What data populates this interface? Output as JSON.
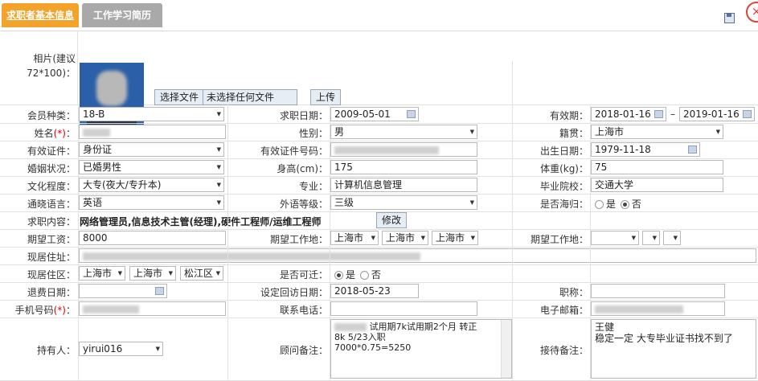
{
  "tabs": [
    "求职者基本信息",
    "工作学习简历"
  ],
  "photo": {
    "label": "相片(建议72*100)：",
    "choose_button": "选择文件",
    "no_file": "未选择任何文件",
    "upload_button": "上传"
  },
  "member_type": {
    "label": "会员种类：",
    "value": "18-B"
  },
  "job_date": {
    "label": "求职日期：",
    "value": "2009-05-01"
  },
  "validity": {
    "label": "有效期：",
    "from": "2018-01-16",
    "sep": "–",
    "to": "2019-01-16"
  },
  "name": {
    "label": "姓名",
    "req": "(*)",
    "colon": "："
  },
  "gender": {
    "label": "性别：",
    "value": "男"
  },
  "native": {
    "label": "籍贯：",
    "value": "上海市"
  },
  "id_type": {
    "label": "有效证件：",
    "value": "身份证"
  },
  "id_no": {
    "label": "有效证件号码："
  },
  "birth": {
    "label": "出生日期：",
    "value": "1979-11-18"
  },
  "marital": {
    "label": "婚姻状况：",
    "value": "已婚男性"
  },
  "height": {
    "label": "身高(cm)：",
    "value": "175"
  },
  "weight": {
    "label": "体重(kg)：",
    "value": "75"
  },
  "education": {
    "label": "文化程度：",
    "value": "大专(夜大/专升本)"
  },
  "major": {
    "label": "专业：",
    "value": "计算机信息管理"
  },
  "school": {
    "label": "毕业院校：",
    "value": "交通大学"
  },
  "language": {
    "label": "通晓语言：",
    "value": "英语"
  },
  "lang_level": {
    "label": "外语等级：",
    "value": "三级"
  },
  "returnee": {
    "label": "是否海归：",
    "yes": "是",
    "no": "否"
  },
  "job_content": {
    "label": "求职内容：",
    "value": "网络管理员,信息技术主管(经理),硬件工程师/运维工程师",
    "edit_button": "修改"
  },
  "salary": {
    "label": "期望工资：",
    "value": "8000"
  },
  "work_place": {
    "label": "期望工作地：",
    "v1": "上海市",
    "v2": "上海市",
    "v3": "上海市"
  },
  "work_place2": {
    "label": "期望工作地："
  },
  "address": {
    "label": "现居住址："
  },
  "area": {
    "label": "现居住区：",
    "v1": "上海市",
    "v2": "上海市",
    "v3": "松江区"
  },
  "transfer": {
    "label": "是否可迁：",
    "yes": "是",
    "no": "否"
  },
  "refund": {
    "label": "退费日期："
  },
  "visit": {
    "label": "设定回访日期：",
    "value": "2018-05-23"
  },
  "title": {
    "label": "职称："
  },
  "mobile": {
    "label": "手机号码",
    "req": "(*)",
    "colon": "："
  },
  "phone": {
    "label": "联系电话："
  },
  "email": {
    "label": "电子邮箱："
  },
  "holder": {
    "label": "持有人：",
    "value": "yirui016"
  },
  "consultant_note": {
    "label": "顾问备注：",
    "line1": "试用期7k试用期2个月 转正",
    "line2": "8k 5/23入职",
    "line3": "7000*0.75=5250"
  },
  "reception_note": {
    "label": "接待备注：",
    "line1": "王健",
    "line2": "稳定一定 大专毕业证书找不到了"
  }
}
